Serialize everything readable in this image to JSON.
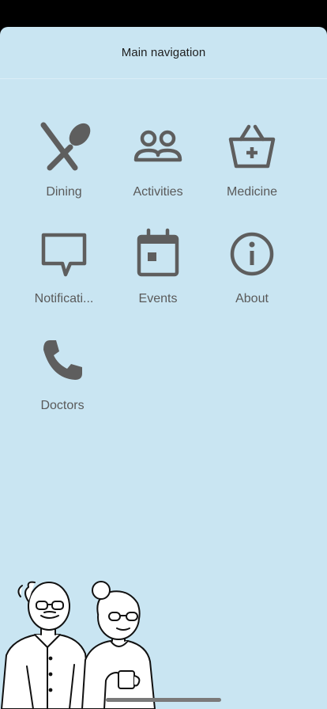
{
  "header": {
    "title": "Main navigation"
  },
  "menu": [
    {
      "label": "Dining",
      "icon": "fork-spoon-icon"
    },
    {
      "label": "Activities",
      "icon": "people-icon"
    },
    {
      "label": "Medicine",
      "icon": "medical-basket-icon"
    },
    {
      "label": "Notificati...",
      "icon": "chat-bubble-icon"
    },
    {
      "label": "Events",
      "icon": "calendar-icon"
    },
    {
      "label": "About",
      "icon": "info-icon"
    },
    {
      "label": "Doctors",
      "icon": "phone-icon"
    }
  ],
  "colors": {
    "background": "#c9e5f2",
    "icon": "#5e5e5e",
    "label": "#5a5a5a"
  }
}
